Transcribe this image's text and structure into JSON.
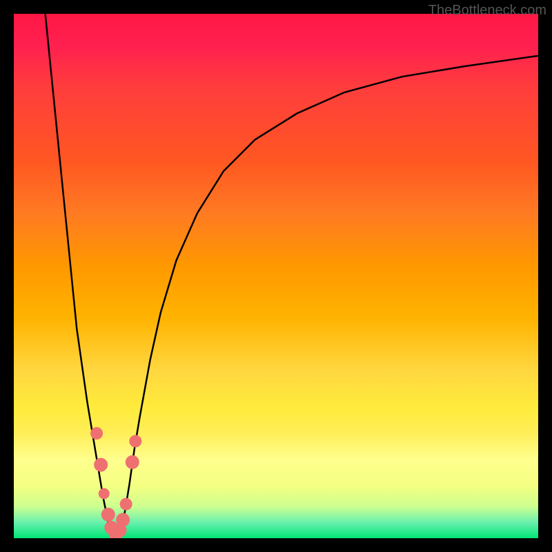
{
  "watermark": "TheBottleneck.com",
  "chart_data": {
    "type": "line",
    "title": "",
    "xlabel": "",
    "ylabel": "",
    "xlim": [
      0,
      100
    ],
    "ylim": [
      0,
      100
    ],
    "grid": false,
    "legend": false,
    "curves": {
      "left": [
        {
          "x": 6,
          "y": 100
        },
        {
          "x": 8,
          "y": 80
        },
        {
          "x": 10,
          "y": 60
        },
        {
          "x": 12,
          "y": 40
        },
        {
          "x": 14,
          "y": 26
        },
        {
          "x": 15,
          "y": 20
        },
        {
          "x": 16,
          "y": 14
        },
        {
          "x": 17,
          "y": 8
        },
        {
          "x": 18,
          "y": 3
        },
        {
          "x": 19,
          "y": 1
        },
        {
          "x": 19.5,
          "y": 0.5
        }
      ],
      "right": [
        {
          "x": 19.5,
          "y": 0.5
        },
        {
          "x": 20,
          "y": 1
        },
        {
          "x": 21,
          "y": 4
        },
        {
          "x": 22,
          "y": 10
        },
        {
          "x": 23,
          "y": 17
        },
        {
          "x": 24,
          "y": 23
        },
        {
          "x": 26,
          "y": 34
        },
        {
          "x": 28,
          "y": 43
        },
        {
          "x": 31,
          "y": 53
        },
        {
          "x": 35,
          "y": 62
        },
        {
          "x": 40,
          "y": 70
        },
        {
          "x": 46,
          "y": 76
        },
        {
          "x": 54,
          "y": 81
        },
        {
          "x": 63,
          "y": 85
        },
        {
          "x": 74,
          "y": 88
        },
        {
          "x": 86,
          "y": 90
        },
        {
          "x": 100,
          "y": 92
        }
      ]
    },
    "markers": [
      {
        "x": 15.8,
        "y": 20,
        "r": 9
      },
      {
        "x": 16.6,
        "y": 14,
        "r": 10
      },
      {
        "x": 17.2,
        "y": 8.5,
        "r": 8
      },
      {
        "x": 18.0,
        "y": 4.5,
        "r": 10
      },
      {
        "x": 18.6,
        "y": 2.0,
        "r": 10
      },
      {
        "x": 19.4,
        "y": 0.8,
        "r": 10
      },
      {
        "x": 20.2,
        "y": 1.5,
        "r": 10
      },
      {
        "x": 20.8,
        "y": 3.5,
        "r": 10
      },
      {
        "x": 21.4,
        "y": 6.5,
        "r": 9
      },
      {
        "x": 22.6,
        "y": 14.5,
        "r": 10
      },
      {
        "x": 23.2,
        "y": 18.5,
        "r": 9
      }
    ]
  }
}
